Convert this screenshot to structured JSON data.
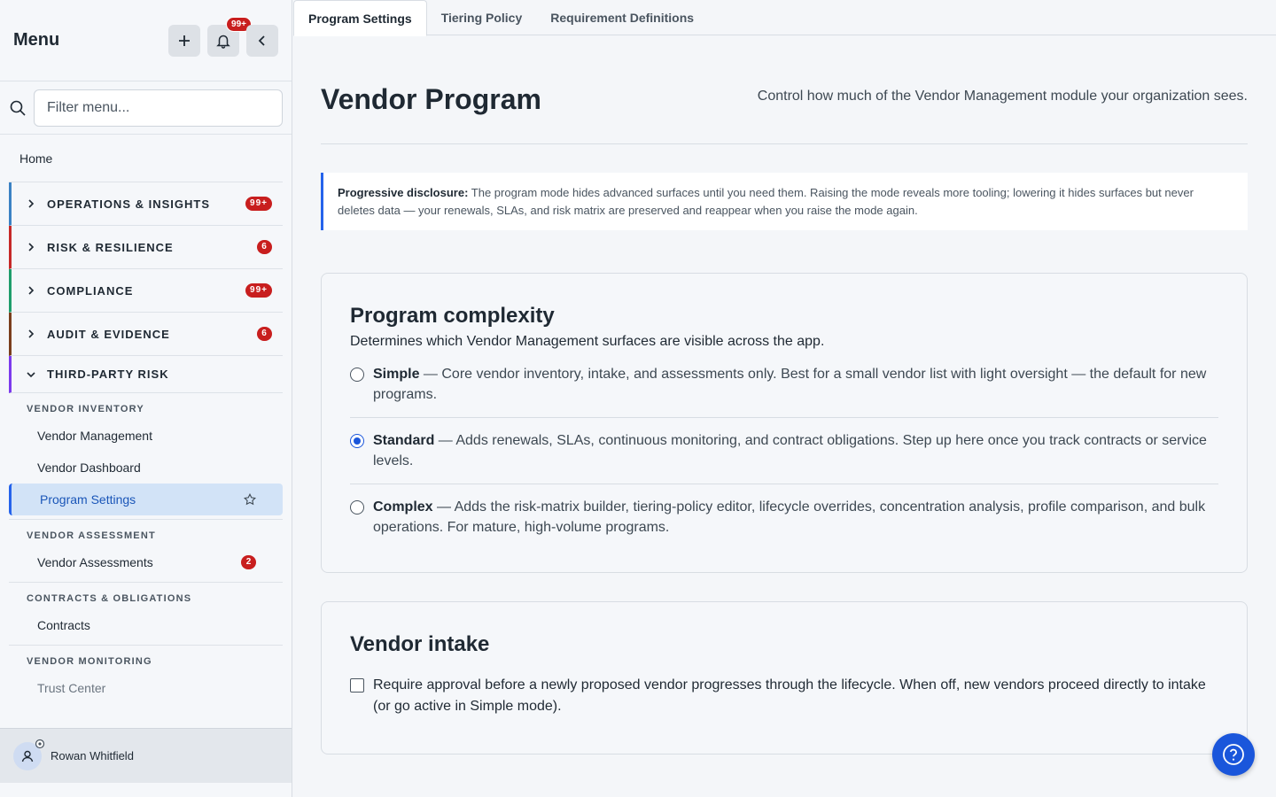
{
  "sidebar": {
    "title": "Menu",
    "notif_count": "99+",
    "filter_placeholder": "Filter menu...",
    "home": "Home",
    "sections": [
      {
        "label": "OPERATIONS & INSIGHTS",
        "count": "99+",
        "color": "#3b82c4"
      },
      {
        "label": "RISK & RESILIENCE",
        "count": "6",
        "color": "#c62828"
      },
      {
        "label": "COMPLIANCE",
        "count": "99+",
        "color": "#1f9d6b"
      },
      {
        "label": "AUDIT & EVIDENCE",
        "count": "6",
        "color": "#7a3e1d"
      },
      {
        "label": "THIRD-PARTY RISK",
        "color": "#7c3aed"
      }
    ],
    "groups": [
      {
        "heading": "VENDOR INVENTORY",
        "items": [
          "Vendor Management",
          "Vendor Dashboard",
          "Program Settings"
        ]
      },
      {
        "heading": "VENDOR ASSESSMENT",
        "items": [
          "Vendor Assessments"
        ],
        "count": "2"
      },
      {
        "heading": "CONTRACTS & OBLIGATIONS",
        "items": [
          "Contracts"
        ]
      },
      {
        "heading": "VENDOR MONITORING",
        "items": [
          "Trust Center"
        ]
      }
    ],
    "user": "Rowan Whitfield"
  },
  "tabs": [
    "Program Settings",
    "Tiering Policy",
    "Requirement Definitions"
  ],
  "page": {
    "title": "Vendor Program",
    "subtitle": "Control how much of the Vendor Management module your organization sees."
  },
  "callout": {
    "lead": "Progressive disclosure:",
    "text": " The program mode hides advanced surfaces until you need them. Raising the mode reveals more tooling; lowering it hides surfaces but never deletes data — your renewals, SLAs, and risk matrix are preserved and reappear when you raise the mode again."
  },
  "complexity": {
    "title": "Program complexity",
    "desc": "Determines which Vendor Management surfaces are visible across the app.",
    "options": [
      {
        "name": "Simple",
        "text": " — Core vendor inventory, intake, and assessments only. Best for a small vendor list with light oversight — the default for new programs.",
        "selected": false
      },
      {
        "name": "Standard",
        "text": " — Adds renewals, SLAs, continuous monitoring, and contract obligations. Step up here once you track contracts or service levels.",
        "selected": true
      },
      {
        "name": "Complex",
        "text": " — Adds the risk-matrix builder, tiering-policy editor, lifecycle overrides, concentration analysis, profile comparison, and bulk operations. For mature, high-volume programs.",
        "selected": false
      }
    ]
  },
  "intake": {
    "title": "Vendor intake",
    "text": "Require approval before a newly proposed vendor progresses through the lifecycle. When off, new vendors proceed directly to intake (or go active in Simple mode).",
    "checked": false
  }
}
